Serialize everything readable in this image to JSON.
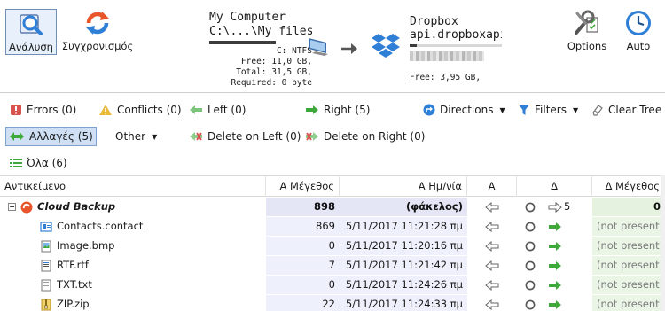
{
  "toolbar": {
    "analyze_label": "Ανάλυση",
    "sync_label": "Συγχρονισμός",
    "options_label": "Options",
    "auto_label": "Auto"
  },
  "left_endpoint": {
    "name": "My Computer",
    "path": "C:\\...\\My files",
    "fs": "C: NTFS",
    "free": "Free: 11,0 GB,",
    "total": "Total: 31,5 GB,",
    "required": "Required: 0 byte",
    "usage_fraction": 0.65
  },
  "right_endpoint": {
    "name": "Dropbox",
    "path": "api.dropboxapi.c",
    "free": "Free: 3,95 GB,",
    "usage_fraction": 0.08
  },
  "filters_row1": {
    "errors": "Errors (0)",
    "conflicts": "Conflicts (0)",
    "left": "Left (0)",
    "right": "Right (5)",
    "directions": "Directions",
    "filters": "Filters",
    "clear_tree": "Clear Tree"
  },
  "filters_row2": {
    "changes": "Αλλαγές (5)",
    "other": "Other",
    "delete_left": "Delete on Left (0)",
    "delete_right": "Delete on Right (0)"
  },
  "filters_row3": {
    "all": "Όλα (6)"
  },
  "table": {
    "headers": {
      "name": "Αντικείμενο",
      "size": "Α Μέγεθος",
      "date": "Α Ημ/νία",
      "left": "Α",
      "mid": "Δ",
      "right_size": "Δ Μέγεθος"
    },
    "parent": {
      "name": "Cloud Backup",
      "size": "898",
      "date": "(φάκελος)",
      "count": "5",
      "right_size": "0"
    },
    "rows": [
      {
        "name": "Contacts.contact",
        "size": "869",
        "date": "5/11/2017 11:21:28 πμ",
        "right_size": "(not present)",
        "icon": "contact-file-icon"
      },
      {
        "name": "Image.bmp",
        "size": "0",
        "date": "5/11/2017 11:20:16 πμ",
        "right_size": "(not present)",
        "icon": "image-file-icon"
      },
      {
        "name": "RTF.rtf",
        "size": "7",
        "date": "5/11/2017 11:21:42 πμ",
        "right_size": "(not present)",
        "icon": "rtf-file-icon"
      },
      {
        "name": "TXT.txt",
        "size": "0",
        "date": "5/11/2017 11:24:26 πμ",
        "right_size": "(not present)",
        "icon": "text-file-icon"
      },
      {
        "name": "ZIP.zip",
        "size": "22",
        "date": "5/11/2017 11:24:33 πμ",
        "right_size": "(not present)",
        "icon": "zip-file-icon"
      }
    ]
  },
  "colors": {
    "accent_blue": "#2f7fd6",
    "sync_orange": "#e8552b",
    "green_arrow": "#3ea83a",
    "error_red": "#d9534f",
    "warning_yellow": "#e9b93a"
  }
}
